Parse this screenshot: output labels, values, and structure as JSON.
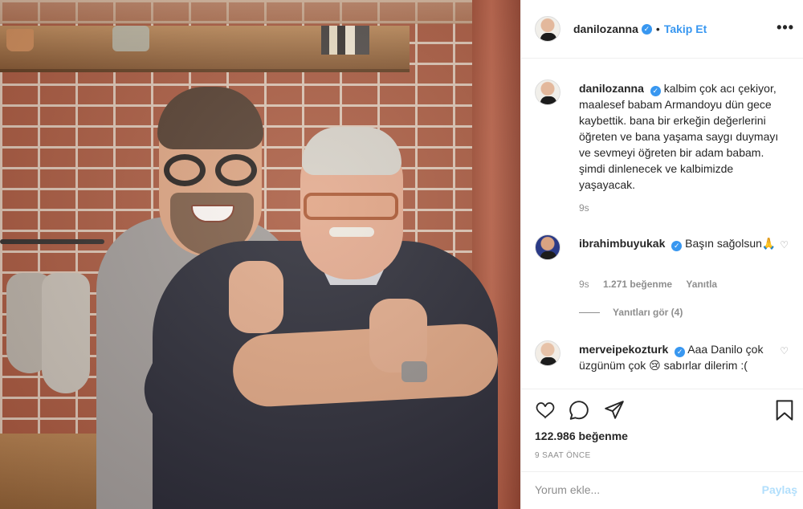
{
  "post": {
    "image_alt": "",
    "author": "danilozanna",
    "follow_label": "Takip Et",
    "separator": "•",
    "more_label": "•••"
  },
  "caption": {
    "user": "danilozanna",
    "text": "kalbim çok acı çekiyor, maalesef babam Armandoyu dün gece kaybettik. bana bir erkeğin değerlerini öğreten ve bana yaşama saygı duymayı ve sevmeyi öğreten bir adam babam. şimdi dinlenecek ve kalbimizde yaşayacak.",
    "time": "9s"
  },
  "comments": [
    {
      "user": "ibrahimbuyukak",
      "text": "Başın sağolsun🙏",
      "time": "9s",
      "likes": "1.271 beğenme",
      "reply_label": "Yanıtla"
    },
    {
      "user": "merveipekozturk",
      "text": "Aaa Danilo çok üzgünüm çok 😢 sabırlar dilerim :(",
      "time": "",
      "likes": "",
      "reply_label": ""
    }
  ],
  "replies_toggle": "Yanıtları gör (4)",
  "actions": {
    "like_icon": "heart-icon",
    "comment_icon": "comment-icon",
    "share_icon": "share-icon",
    "save_icon": "bookmark-icon"
  },
  "likes": "122.986 beğenme",
  "timestamp": "9 SAAT ÖNCE",
  "comment_box": {
    "placeholder": "Yorum ekle...",
    "post_label": "Paylaş"
  },
  "colors": {
    "link": "#3897f0",
    "verified": "#3897f0",
    "muted": "#8e8e8e",
    "post_disabled": "#b2dffc"
  }
}
